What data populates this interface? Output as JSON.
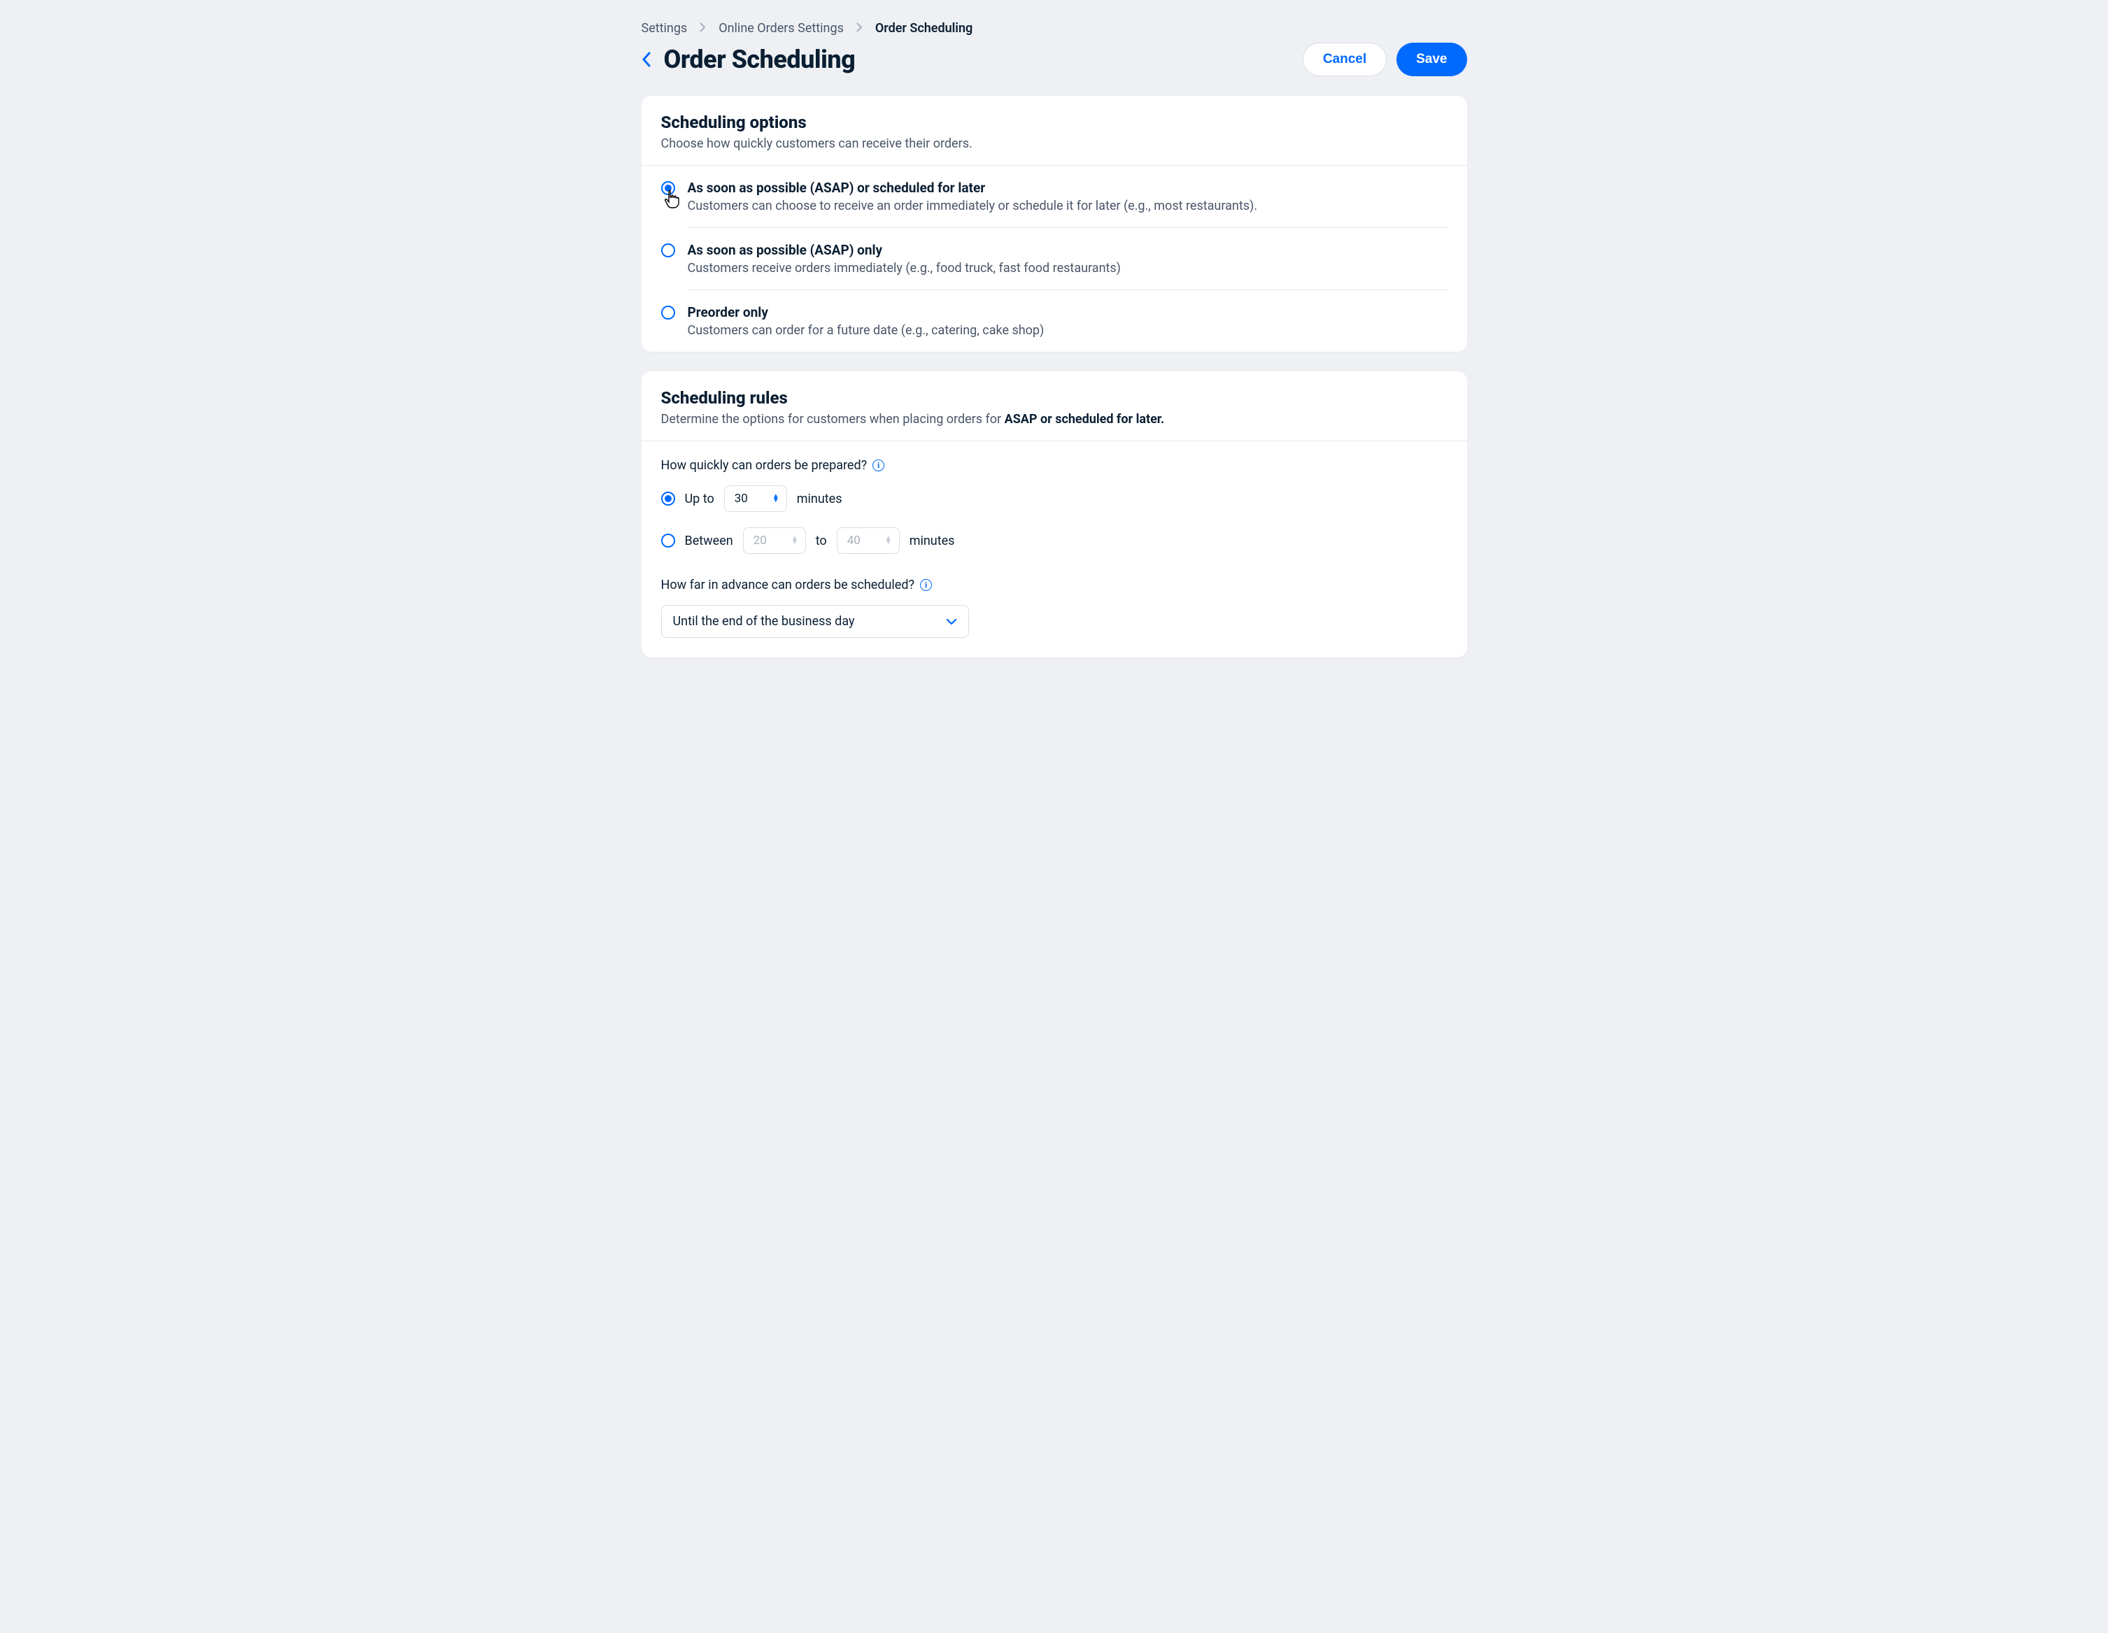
{
  "breadcrumb": {
    "items": [
      "Settings",
      "Online Orders Settings",
      "Order Scheduling"
    ]
  },
  "header": {
    "title": "Order Scheduling",
    "cancel": "Cancel",
    "save": "Save"
  },
  "scheduling_options": {
    "title": "Scheduling options",
    "subtitle": "Choose how quickly customers can receive their orders.",
    "options": [
      {
        "title": "As soon as possible (ASAP) or scheduled for later",
        "desc": "Customers can choose to receive an order immediately or schedule it for later (e.g., most restaurants).",
        "selected": true
      },
      {
        "title": "As soon as possible (ASAP)  only",
        "desc": "Customers receive orders immediately (e.g., food truck, fast food restaurants)",
        "selected": false
      },
      {
        "title": "Preorder only",
        "desc": "Customers can order for a future date (e.g., catering, cake shop)",
        "selected": false
      }
    ]
  },
  "scheduling_rules": {
    "title": "Scheduling rules",
    "desc_prefix": "Determine the options for customers when placing orders for ",
    "desc_bold": "ASAP or scheduled for later.",
    "q1": "How quickly can orders be prepared?",
    "upto_label": "Up to",
    "upto_value": "30",
    "minutes_label": "minutes",
    "between_label": "Between",
    "between_from": "20",
    "to_label": "to",
    "between_to": "40",
    "q2": "How far in advance can orders be scheduled?",
    "advance_value": "Until the end of the business day"
  }
}
